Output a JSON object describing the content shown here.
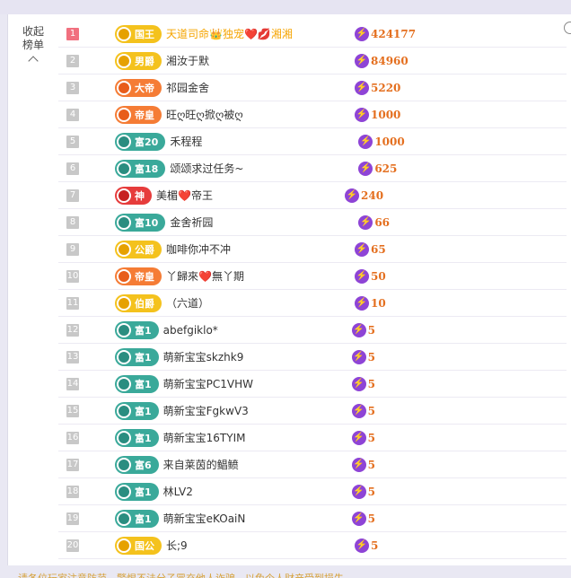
{
  "collapse_label": "收起榜单",
  "footer_text": "请各位玩家注意防范，警惕不法分子冒充他人诈骗，以免个人财产受到损失",
  "colors": {
    "accent_score": "#e46f1f",
    "bolt": "#8e44d6",
    "rank_first": "#f1707f"
  },
  "rows": [
    {
      "rank": "1",
      "badge": "国王",
      "badge_style": "gold",
      "name": "天道司命👑独宠❤️💋湘湘",
      "score": "424177"
    },
    {
      "rank": "2",
      "badge": "男爵",
      "badge_style": "gold",
      "name": "湘汝于默",
      "score": "84960"
    },
    {
      "rank": "3",
      "badge": "大帝",
      "badge_style": "orange",
      "name": "祁园金舍",
      "score": "5220"
    },
    {
      "rank": "4",
      "badge": "帝皇",
      "badge_style": "orange",
      "name": "旺ღ旺ღ掀ღ被ღ",
      "score": "1000"
    },
    {
      "rank": "5",
      "badge": "富20",
      "badge_style": "teal",
      "name": "禾程程",
      "score": "1000"
    },
    {
      "rank": "6",
      "badge": "富18",
      "badge_style": "teal",
      "name": "颂颂求过任务~",
      "score": "625"
    },
    {
      "rank": "7",
      "badge": "神",
      "badge_style": "red",
      "name": "美楣❤️帝王",
      "score": "240"
    },
    {
      "rank": "8",
      "badge": "富10",
      "badge_style": "teal",
      "name": "金舍祈园",
      "score": "66"
    },
    {
      "rank": "9",
      "badge": "公爵",
      "badge_style": "gold",
      "name": "咖啡你冲不冲",
      "score": "65"
    },
    {
      "rank": "10",
      "badge": "帝皇",
      "badge_style": "orange",
      "name": "丫歸來❤️無丫期",
      "score": "50"
    },
    {
      "rank": "11",
      "badge": "伯爵",
      "badge_style": "gold",
      "name": "（六道）",
      "score": "10"
    },
    {
      "rank": "12",
      "badge": "富1",
      "badge_style": "teal",
      "name": "abefgiklo*",
      "score": "5"
    },
    {
      "rank": "13",
      "badge": "富1",
      "badge_style": "teal",
      "name": "萌新宝宝skzhk9",
      "score": "5"
    },
    {
      "rank": "14",
      "badge": "富1",
      "badge_style": "teal",
      "name": "萌新宝宝PC1VHW",
      "score": "5"
    },
    {
      "rank": "15",
      "badge": "富1",
      "badge_style": "teal",
      "name": "萌新宝宝FgkwV3",
      "score": "5"
    },
    {
      "rank": "16",
      "badge": "富1",
      "badge_style": "teal",
      "name": "萌新宝宝16TYIM",
      "score": "5"
    },
    {
      "rank": "17",
      "badge": "富6",
      "badge_style": "teal",
      "name": "来自莱茵的鲳鲼",
      "score": "5"
    },
    {
      "rank": "18",
      "badge": "富1",
      "badge_style": "teal",
      "name": "林LV2",
      "score": "5"
    },
    {
      "rank": "19",
      "badge": "富1",
      "badge_style": "teal",
      "name": "萌新宝宝eKOaiN",
      "score": "5"
    },
    {
      "rank": "20",
      "badge": "国公",
      "badge_style": "gold",
      "name": "长;9",
      "score": "5"
    }
  ]
}
